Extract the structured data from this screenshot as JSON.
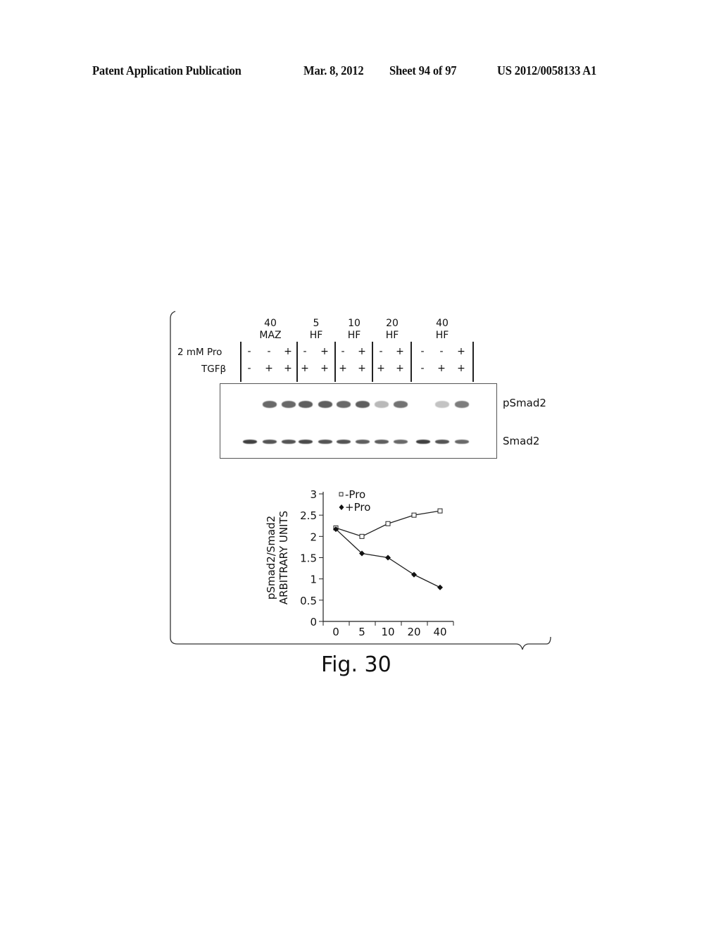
{
  "header": {
    "publication": "Patent Application Publication",
    "date": "Mar. 8, 2012",
    "sheet": "Sheet 94 of 97",
    "patent_number": "US 2012/0058133 A1"
  },
  "blot": {
    "lane_groups": [
      {
        "line1": "40",
        "line2": "MAZ"
      },
      {
        "line1": "5",
        "line2": "HF"
      },
      {
        "line1": "10",
        "line2": "HF"
      },
      {
        "line1": "20",
        "line2": "HF"
      },
      {
        "line1": "40",
        "line2": "HF"
      }
    ],
    "row_labels": {
      "pro": "2 mM Pro",
      "tgf": "TGFβ"
    },
    "pro": [
      "-",
      "-",
      "+",
      "-",
      "+",
      "-",
      "+",
      "-",
      "+",
      "-",
      "-",
      "+"
    ],
    "tgf": [
      "-",
      "+",
      "+",
      "+",
      "+",
      "+",
      "+",
      "+",
      "+",
      "-",
      "+",
      "+"
    ],
    "band_labels": {
      "top": "pSmad2",
      "bottom": "Smad2"
    },
    "psmad2_intensity": [
      0,
      0.75,
      0.75,
      0.8,
      0.8,
      0.75,
      0.8,
      0.35,
      0.7,
      0,
      0.3,
      0.65
    ],
    "smad2_intensity": [
      0.95,
      0.85,
      0.85,
      0.9,
      0.85,
      0.85,
      0.8,
      0.8,
      0.75,
      0.95,
      0.85,
      0.75
    ]
  },
  "chart_data": {
    "type": "line",
    "title": "",
    "xlabel": "",
    "ylabel_line1": "pSmad2/Smad2",
    "ylabel_line2": "ARBITRARY UNITS",
    "categories": [
      "0",
      "5",
      "10",
      "20",
      "40"
    ],
    "ylim": [
      0,
      3
    ],
    "yticks": [
      0,
      0.5,
      1,
      1.5,
      2,
      2.5,
      3
    ],
    "ytick_labels": [
      "0",
      "0.5",
      "1",
      "1.5",
      "2",
      "2.5",
      "3"
    ],
    "grid": false,
    "legend_position": "top-left",
    "series": [
      {
        "name": "-Pro",
        "marker": "open-square",
        "values": [
          2.2,
          2.0,
          2.3,
          2.5,
          2.6
        ]
      },
      {
        "name": "+Pro",
        "marker": "filled-diamond",
        "values": [
          2.17,
          1.6,
          1.5,
          1.1,
          0.8
        ]
      }
    ]
  },
  "figure_caption": "Fig. 30"
}
